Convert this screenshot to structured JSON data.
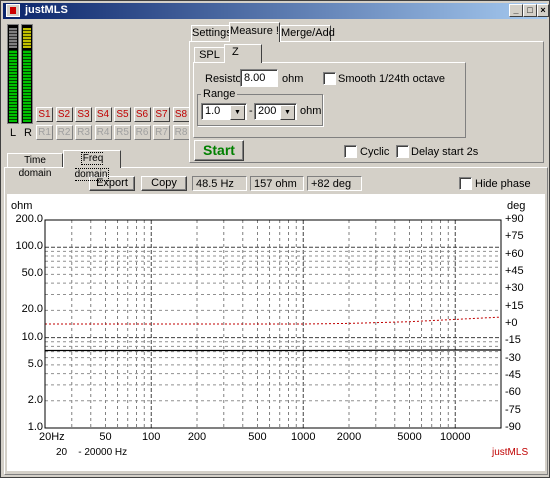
{
  "window": {
    "title": "justMLS",
    "minimize": "_",
    "maximize": "□",
    "close": "×"
  },
  "meters": {
    "left_label": "L",
    "right_label": "R"
  },
  "storage": {
    "save_slots": [
      "S1",
      "S2",
      "S3",
      "S4",
      "S5",
      "S6",
      "S7",
      "S8"
    ],
    "recall_slots": [
      "R1",
      "R2",
      "R3",
      "R4",
      "R5",
      "R6",
      "R7",
      "R8"
    ]
  },
  "main_tabs": {
    "settings": "Settings",
    "measure": "Measure !",
    "merge": "Merge/Add"
  },
  "sub_tabs": {
    "spl": "SPL",
    "z": "Z"
  },
  "measure": {
    "resistor_label": "Resistor",
    "resistor_value": "8.00",
    "resistor_unit": "ohm",
    "smooth_label": "Smooth 1/24th octave",
    "range_label": "Range",
    "range_from": "1.0",
    "range_dash": "-",
    "range_to": "200",
    "range_unit": "ohm",
    "start_label": "Start",
    "cyclic_label": "Cyclic",
    "delay_label": "Delay start 2s"
  },
  "view_tabs": {
    "time": "Time domain",
    "freq": "Freq domain"
  },
  "toolbar": {
    "export_label": "Export",
    "copy_label": "Copy",
    "readout_freq": "48.5 Hz",
    "readout_ohm": "157 ohm",
    "readout_deg": "+82 deg",
    "hide_phase_label": "Hide phase"
  },
  "chart_data": {
    "type": "line",
    "title": "",
    "ylabel_left": "ohm",
    "ylabel_right": "deg",
    "x_scale": "log",
    "y_scale_left": "log",
    "xlim": [
      20,
      20000
    ],
    "ylim_left": [
      1.0,
      200.0
    ],
    "ylim_right": [
      -90,
      90
    ],
    "x_ticks": [
      "20Hz",
      "50",
      "100",
      "200",
      "500",
      "1000",
      "2000",
      "5000",
      "10000"
    ],
    "x_tick_values": [
      20,
      50,
      100,
      200,
      500,
      1000,
      2000,
      5000,
      10000
    ],
    "y_ticks_left": [
      "200.0",
      "100.0",
      "50.0",
      "20.0",
      "10.0",
      "5.0",
      "2.0",
      "1.0"
    ],
    "y_tick_values_left": [
      200,
      100,
      50,
      20,
      10,
      5,
      2,
      1
    ],
    "y_ticks_right": [
      "+90",
      "+75",
      "+60",
      "+45",
      "+30",
      "+15",
      "+0",
      "-15",
      "-30",
      "-45",
      "-60",
      "-75",
      "-90"
    ],
    "y_tick_values_right": [
      90,
      75,
      60,
      45,
      30,
      15,
      0,
      -15,
      -30,
      -45,
      -60,
      -75,
      -90
    ],
    "grid": true,
    "range_caption": "20    - 20000 Hz",
    "watermark": "justMLS",
    "series": [
      {
        "name": "",
        "axis": "left",
        "color": "#000000",
        "x": [
          20,
          100,
          1000,
          10000,
          20000
        ],
        "y": [
          7.2,
          7.2,
          7.2,
          7.3,
          7.3
        ]
      },
      {
        "name": "",
        "axis": "right",
        "color": "#c00000",
        "x": [
          20,
          100,
          500,
          1000,
          2000,
          5000,
          10000,
          20000
        ],
        "y": [
          0,
          0,
          0,
          0,
          0.5,
          2,
          4,
          6
        ]
      }
    ]
  },
  "colors": {
    "title_bar": "#0a246a",
    "meter_green": "#00c000",
    "meter_yellow": "#c0c000",
    "save_red": "#c00000",
    "start_green": "#008000",
    "phase_red": "#c00000"
  }
}
